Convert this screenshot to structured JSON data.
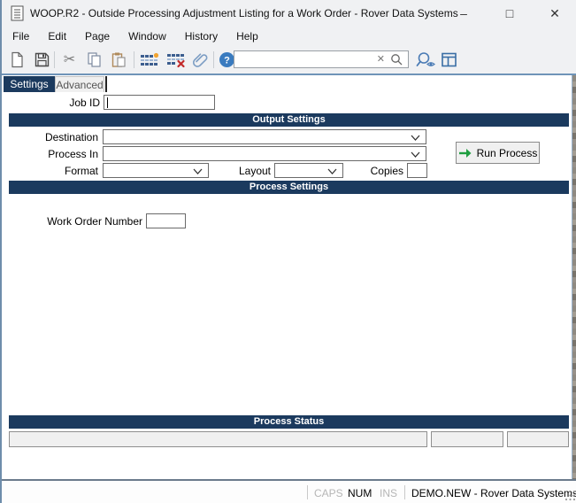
{
  "window": {
    "title": "WOOP.R2 - Outside Processing Adjustment Listing for a Work Order - Rover Data Systems",
    "minimize": "–",
    "maximize": "□",
    "close": "✕"
  },
  "menu": {
    "items": [
      "File",
      "Edit",
      "Page",
      "Window",
      "History",
      "Help"
    ]
  },
  "toolbar": {
    "search_value": "",
    "icons": [
      "new-document",
      "save",
      "cut",
      "copy",
      "paste",
      "add-record",
      "delete-record",
      "attachment",
      "help",
      "find-view",
      "window-layout"
    ]
  },
  "tabs": [
    {
      "label": "Settings",
      "active": true
    },
    {
      "label": "Advanced",
      "active": false
    }
  ],
  "form": {
    "job_id": {
      "label": "Job ID",
      "value": ""
    },
    "output_settings": {
      "title": "Output Settings",
      "destination_label": "Destination",
      "destination_value": "",
      "process_in_label": "Process In",
      "process_in_value": "",
      "format_label": "Format",
      "format_value": "",
      "layout_label": "Layout",
      "layout_value": "",
      "copies_label": "Copies",
      "copies_value": "",
      "run_button_label": "Run Process"
    },
    "process_settings": {
      "title": "Process Settings",
      "work_order_label": "Work Order Number",
      "work_order_value": ""
    },
    "process_status": {
      "title": "Process Status",
      "cells": [
        "",
        "",
        ""
      ]
    }
  },
  "statusbar": {
    "caps": "CAPS",
    "num": "NUM",
    "ins": "INS",
    "context": "DEMO.NEW - Rover Data Systems"
  },
  "colors": {
    "navy": "#1b3a5e",
    "chrome_bg": "#f0f1f3",
    "divider_blue": "#6f94b8",
    "run_arrow_green": "#1f9e40",
    "help_blue": "#3a7bbf"
  }
}
